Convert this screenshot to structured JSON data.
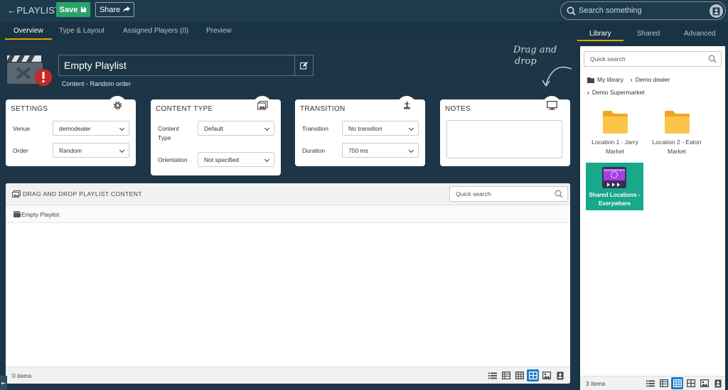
{
  "header": {
    "back_label": "PLAYLIST",
    "save_label": "Save",
    "share_label": "Share",
    "search_placeholder": "Search something"
  },
  "tabs": [
    {
      "label": "Overview",
      "active": true
    },
    {
      "label": "Type & Layout",
      "active": false
    },
    {
      "label": "Assigned Players (0)",
      "active": false
    },
    {
      "label": "Preview",
      "active": false
    }
  ],
  "playlist": {
    "title": "Empty Playlist",
    "subtitle": "Content - Random order",
    "drag_hint_line1": "Drag and",
    "drag_hint_line2": "drop"
  },
  "settings": {
    "title": "SETTINGS",
    "venue_label": "Venue",
    "venue_value": "demodealer",
    "order_label": "Order",
    "order_value": "Random"
  },
  "content_type": {
    "title": "CONTENT TYPE",
    "type_label_1": "Content",
    "type_label_2": "Type",
    "type_value": "Default",
    "orientation_label": "Orientation",
    "orientation_value": "Not specified"
  },
  "transition": {
    "title": "TRANSITION",
    "transition_label": "Transition",
    "transition_value": "No transition",
    "duration_label": "Duration",
    "duration_value": "750 ms"
  },
  "notes": {
    "title": "NOTES"
  },
  "content_area": {
    "title": "DRAG AND DROP PLAYLIST CONTENT",
    "search_placeholder": "Quick search",
    "breadcrumb": "Empty Playlist",
    "item_count": "0 items"
  },
  "sidebar": {
    "tabs": [
      {
        "label": "Library",
        "active": true
      },
      {
        "label": "Shared",
        "active": false
      },
      {
        "label": "Advanced",
        "active": false
      }
    ],
    "search_placeholder": "Quick search",
    "breadcrumb": [
      "My library",
      "Demo dealer",
      "Demo Supermarket"
    ],
    "items": [
      {
        "name_line1": "Location 1 - Jarry",
        "name_line2": "Market"
      },
      {
        "name_line1": "Location 2 - Eaton",
        "name_line2": "Market"
      }
    ],
    "shared": {
      "name_line1": "Shared Locations -",
      "name_line2": "Everywhere"
    },
    "item_count": "3 items"
  },
  "colors": {
    "accent": "#e5a100",
    "save": "#2aa36b",
    "active_view": "#1a79c7",
    "shared_tile": "#18a88a"
  }
}
